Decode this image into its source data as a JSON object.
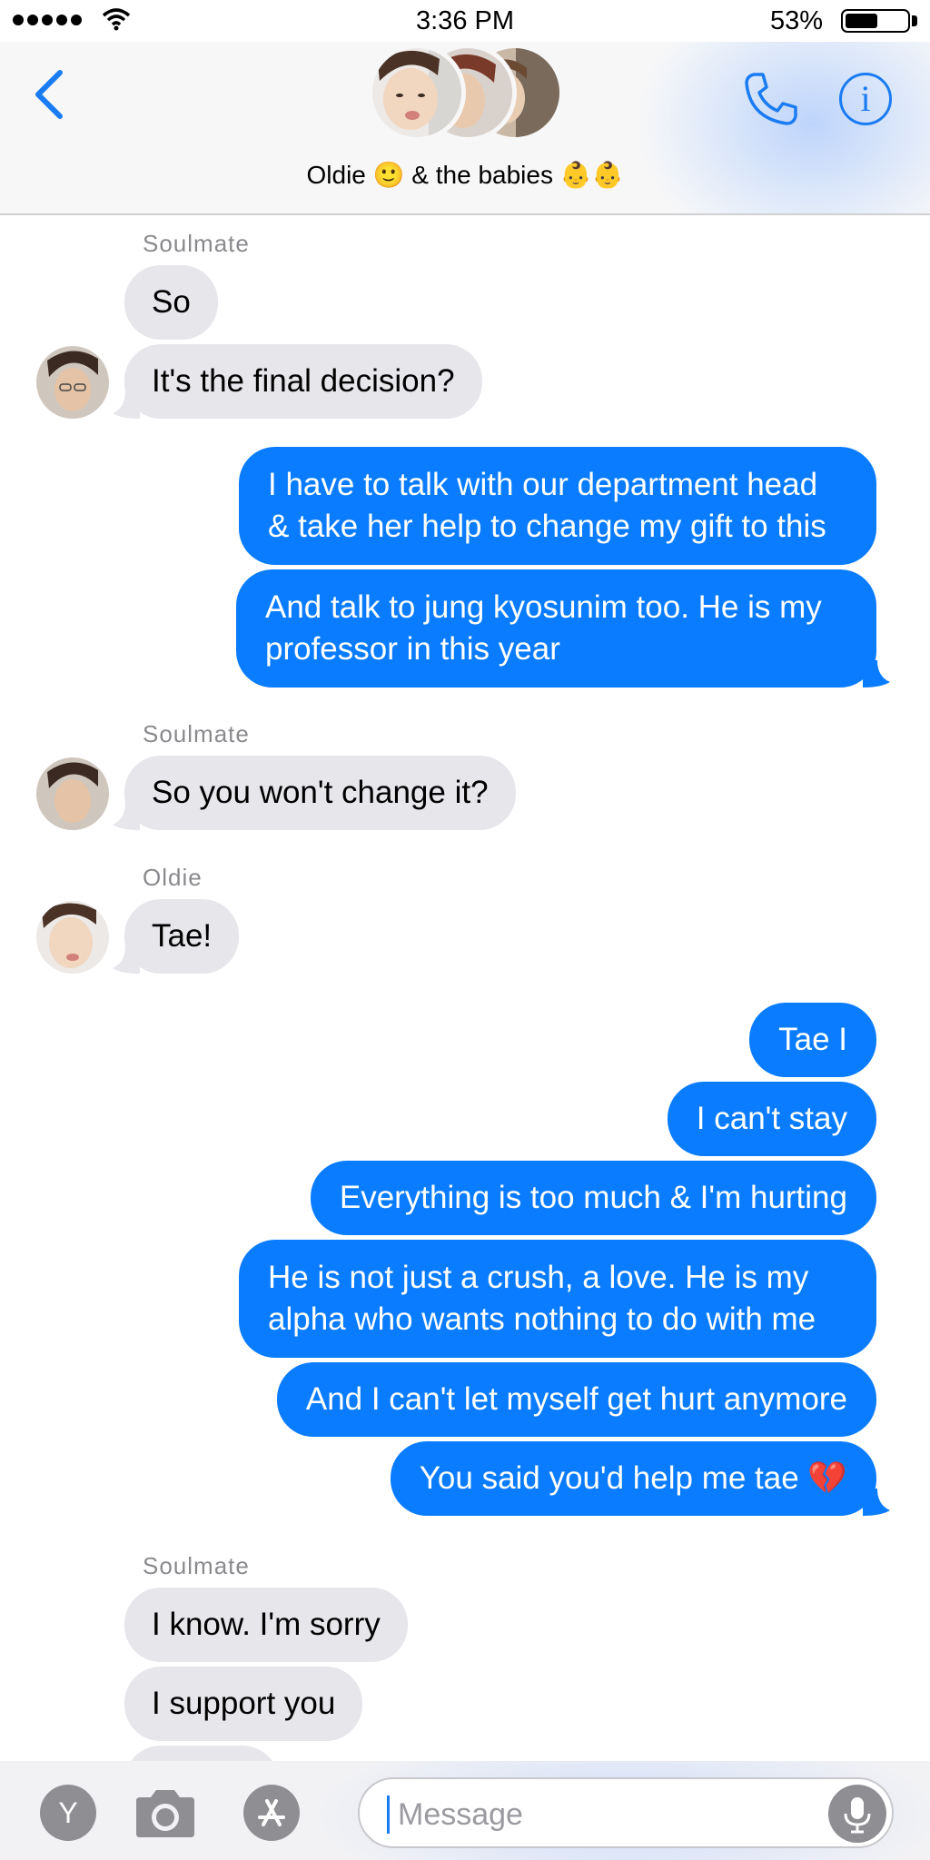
{
  "status_bar": {
    "time": "3:36 PM",
    "battery_percent": "53%",
    "battery_level": 0.53,
    "signal_dots": 5
  },
  "header": {
    "group_name": "Oldie 🙂 & the babies 👶👶",
    "accent_color": "#1a7cf2",
    "info_label": "i"
  },
  "messages": [
    {
      "from": "Soulmate",
      "dir": "in",
      "text": "So"
    },
    {
      "from": "Soulmate",
      "dir": "in",
      "text": "It's the final decision?"
    },
    {
      "from": "me",
      "dir": "out",
      "text": "I have to talk with our department head & take her help to change my gift to this"
    },
    {
      "from": "me",
      "dir": "out",
      "text": "And talk to jung kyosunim too. He is my professor in this year"
    },
    {
      "from": "Soulmate",
      "dir": "in",
      "text": "So you won't change it?"
    },
    {
      "from": "Oldie",
      "dir": "in",
      "text": "Tae!"
    },
    {
      "from": "me",
      "dir": "out",
      "text": "Tae I"
    },
    {
      "from": "me",
      "dir": "out",
      "text": "I can't stay"
    },
    {
      "from": "me",
      "dir": "out",
      "text": "Everything is too much & I'm hurting"
    },
    {
      "from": "me",
      "dir": "out",
      "text": "He is not just a crush, a love. He is my alpha who wants nothing to do with me"
    },
    {
      "from": "me",
      "dir": "out",
      "text": "And I can't let myself get hurt anymore"
    },
    {
      "from": "me",
      "dir": "out",
      "text": "You said you'd help me tae 💔"
    },
    {
      "from": "Soulmate",
      "dir": "in",
      "text": "I know. I'm sorry"
    },
    {
      "from": "Soulmate",
      "dir": "in",
      "text": "I support you"
    }
  ],
  "sender_labels": {
    "soulmate": "Soulmate",
    "oldie": "Oldie"
  },
  "colors": {
    "outgoing_bubble": "#0a7cff",
    "incoming_bubble": "#e6e6eb",
    "sender_label": "#8a8a8e"
  },
  "input_bar": {
    "placeholder": "Message",
    "app_button_label": "Y",
    "icons": [
      "y-app-icon",
      "camera-icon",
      "app-store-icon",
      "microphone-icon"
    ]
  }
}
